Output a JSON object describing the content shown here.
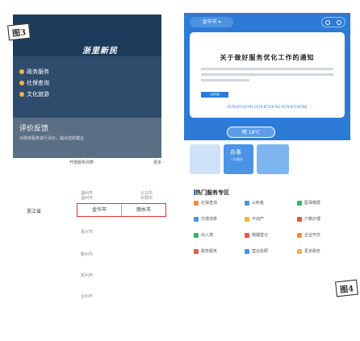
{
  "tags": {
    "a": "图3",
    "b": "图4"
  },
  "left": {
    "banner_title": "浙里新民",
    "menu": [
      "政务服务",
      "社保查询",
      "文化旅游"
    ],
    "card_title": "评价反馈",
    "card_sub": "对政务服务进行评价，提出您的建议",
    "caption_left": "开放服务列表",
    "caption_right": "更多"
  },
  "selector": {
    "label": "浙江省",
    "options": [
      "金华市",
      "丽水市"
    ],
    "faded_left": [
      "湖州市",
      "温州市",
      "嘉兴市",
      "衢州市",
      "杭州市",
      "台州市"
    ],
    "faded_right": [
      "义乌市",
      "东阳市"
    ]
  },
  "right": {
    "pill": "金华市",
    "card_title": "关于做好服务优化工作的通知",
    "badge": "立即查看",
    "phones": "0579-87159791  0579-87159792  0579-87159786",
    "weather": "晴 18℃",
    "thumb_title": "办事",
    "thumb_sub": "一站通办",
    "services_title": "热门服务专区",
    "services": [
      [
        "社保查询",
        "公积金",
        "医保缴费"
      ],
      [
        "交通违章",
        "不动产",
        "户籍办理"
      ],
      [
        "出入境",
        "婚姻登记",
        "企业开办"
      ],
      [
        "税务服务",
        "营业执照",
        "更多服务"
      ]
    ]
  }
}
